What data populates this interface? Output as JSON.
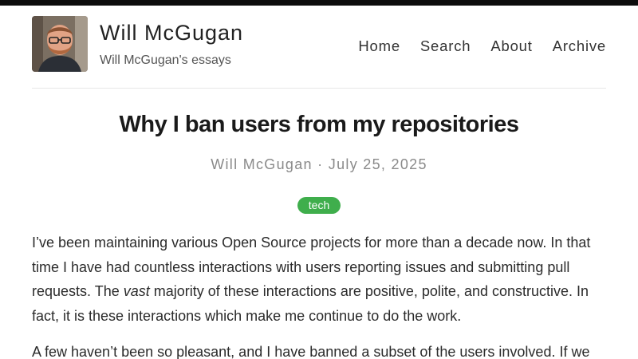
{
  "site": {
    "title": "Will McGugan",
    "subtitle": "Will McGugan's essays"
  },
  "nav": {
    "items": [
      {
        "label": "Home"
      },
      {
        "label": "Search"
      },
      {
        "label": "About"
      },
      {
        "label": "Archive"
      }
    ]
  },
  "post": {
    "title": "Why I ban users from my repositories",
    "author": "Will McGugan",
    "separator": "·",
    "date": "July 25, 2025",
    "tag": "tech",
    "paragraph1": {
      "before": "I’ve been maintaining various Open Source projects for more than a decade now. In that time I have had countless interactions with users reporting issues and submitting pull requests. The ",
      "emphasis": "vast",
      "after": " majority of these interactions are positive, polite, and constructive. In fact, it is these interactions which make me continue to do the work."
    },
    "paragraph2": "A few haven’t been so pleasant, and I have banned a subset of the users involved. If we"
  },
  "colors": {
    "topbar": "#0d0d0d",
    "tag_background": "#3fae4c",
    "meta_text": "#8a8a8a"
  },
  "icons": {
    "avatar": "author-photo"
  }
}
